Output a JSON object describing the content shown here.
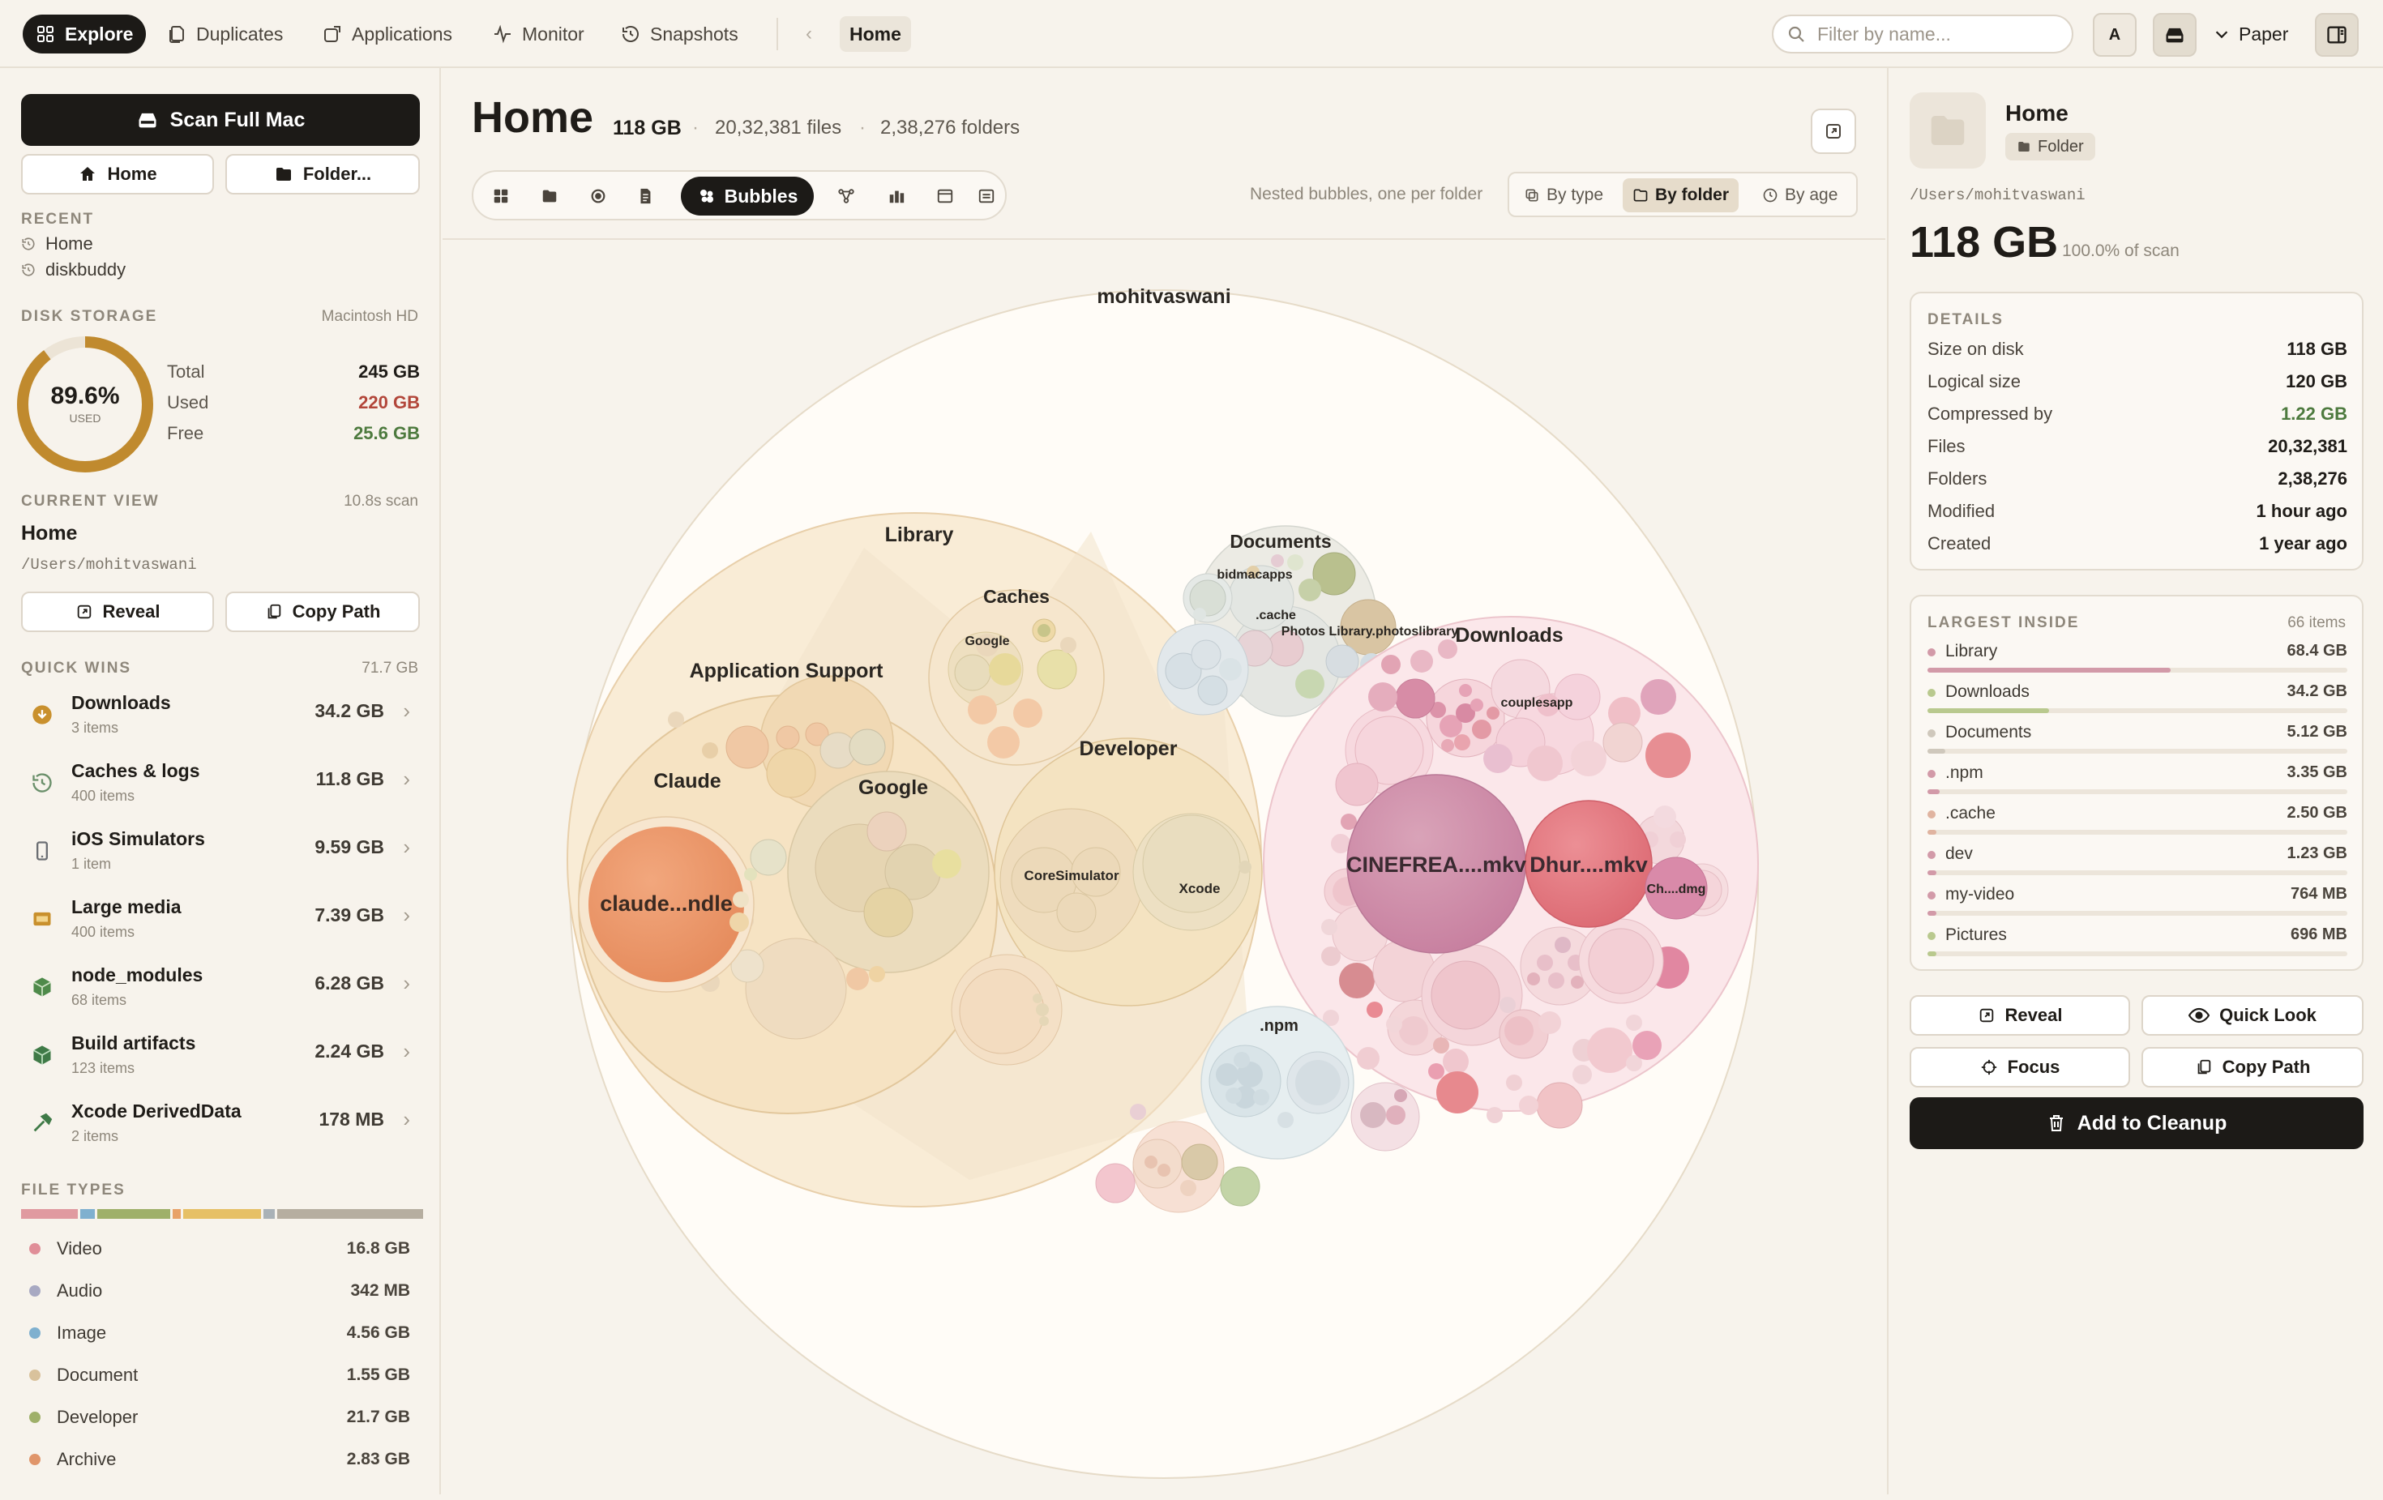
{
  "nav": {
    "tabs": [
      {
        "label": "Explore",
        "icon": "grid-icon"
      },
      {
        "label": "Duplicates",
        "icon": "copy-icon"
      },
      {
        "label": "Applications",
        "icon": "app-icon"
      },
      {
        "label": "Monitor",
        "icon": "pulse-icon"
      },
      {
        "label": "Snapshots",
        "icon": "history-icon"
      }
    ],
    "breadcrumb": "Home",
    "search_placeholder": "Filter by name...",
    "avatar_letter": "A",
    "theme": "Paper"
  },
  "sidebar": {
    "scan_label": "Scan Full Mac",
    "home_label": "Home",
    "folder_label": "Folder...",
    "recent_title": "RECENT",
    "recent": [
      "Home",
      "diskbuddy"
    ],
    "disk": {
      "title": "DISK STORAGE",
      "volume": "Macintosh HD",
      "percent": "89.6%",
      "used_fraction": 0.896,
      "used_caption": "USED",
      "rows": [
        {
          "label": "Total",
          "value": "245 GB",
          "color": "#1f1c18"
        },
        {
          "label": "Used",
          "value": "220 GB",
          "color": "#b2463a"
        },
        {
          "label": "Free",
          "value": "25.6 GB",
          "color": "#4d7a3e"
        }
      ]
    },
    "current": {
      "title": "CURRENT VIEW",
      "scan_time": "10.8s scan",
      "name": "Home",
      "path": "/Users/mohitvaswani",
      "reveal": "Reveal",
      "copy": "Copy Path"
    },
    "quick_wins": {
      "title": "QUICK WINS",
      "total": "71.7 GB",
      "items": [
        {
          "title": "Downloads",
          "sub": "3 items",
          "value": "34.2 GB",
          "icon": "download-icon"
        },
        {
          "title": "Caches & logs",
          "sub": "400 items",
          "value": "11.8 GB",
          "icon": "history-icon"
        },
        {
          "title": "iOS Simulators",
          "sub": "1 item",
          "value": "9.59 GB",
          "icon": "phone-icon"
        },
        {
          "title": "Large media",
          "sub": "400 items",
          "value": "7.39 GB",
          "icon": "film-icon"
        },
        {
          "title": "node_modules",
          "sub": "68 items",
          "value": "6.28 GB",
          "icon": "package-icon"
        },
        {
          "title": "Build artifacts",
          "sub": "123 items",
          "value": "2.24 GB",
          "icon": "box-icon"
        },
        {
          "title": "Xcode DerivedData",
          "sub": "2 items",
          "value": "178 MB",
          "icon": "hammer-icon"
        }
      ]
    },
    "file_types": {
      "title": "FILE TYPES",
      "bar_colors": [
        "#e09aa0",
        "#7fb0cf",
        "#9fb06a",
        "#e8a268",
        "#e6c066",
        "#aab2b7",
        "#b6aea0"
      ],
      "items": [
        {
          "label": "Video",
          "value": "16.8 GB",
          "color": "#e08e98"
        },
        {
          "label": "Audio",
          "value": "342 MB",
          "color": "#a8a9c2"
        },
        {
          "label": "Image",
          "value": "4.56 GB",
          "color": "#7fb0cf"
        },
        {
          "label": "Document",
          "value": "1.55 GB",
          "color": "#d9c29c"
        },
        {
          "label": "Developer",
          "value": "21.7 GB",
          "color": "#9fb06a"
        },
        {
          "label": "Archive",
          "value": "2.83 GB",
          "color": "#e0956a"
        }
      ]
    }
  },
  "main": {
    "title": "Home",
    "size": "118 GB",
    "files": "20,32,381 files",
    "folders": "2,38,276 folders",
    "active_view": "Bubbles",
    "hint": "Nested bubbles, one per folder",
    "color_modes": [
      "By type",
      "By folder",
      "By age"
    ],
    "active_color_mode": "By folder"
  },
  "bubbles": {
    "labels": {
      "root": "mohitvaswani",
      "library": "Library",
      "app_support": "Application Support",
      "claude": "Claude",
      "google": "Google",
      "caches": "Caches",
      "caches_google": "Google",
      "developer": "Developer",
      "coresim": "CoreSimulator",
      "xcode": "Xcode",
      "documents": "Documents",
      "bidmacapps": "bidmacapps",
      "cache": ".cache",
      "photos": "Photos Library.photoslibrary",
      "downloads": "Downloads",
      "couplesapp": "couplesapp",
      "cinefrea": "CINEFREA....mkv",
      "dhur": "Dhur....mkv",
      "chdmg": "Ch....dmg",
      "npm": ".npm",
      "claude_bundle": "claude...ndle"
    }
  },
  "right": {
    "name": "Home",
    "kind": "Folder",
    "path": "/Users/mohitvaswani",
    "size": "118 GB",
    "percent": "100.0% of scan",
    "details_title": "DETAILS",
    "details": [
      {
        "label": "Size on disk",
        "value": "118 GB",
        "color": "#1f1c18"
      },
      {
        "label": "Logical size",
        "value": "120 GB",
        "color": "#1f1c18"
      },
      {
        "label": "Compressed by",
        "value": "1.22 GB",
        "color": "#4d7a3e"
      },
      {
        "label": "Files",
        "value": "20,32,381",
        "color": "#1f1c18"
      },
      {
        "label": "Folders",
        "value": "2,38,276",
        "color": "#1f1c18"
      },
      {
        "label": "Modified",
        "value": "1 hour ago",
        "color": "#1f1c18"
      },
      {
        "label": "Created",
        "value": "1 year ago",
        "color": "#1f1c18"
      }
    ],
    "largest_title": "LARGEST INSIDE",
    "largest_count": "66 items",
    "largest": [
      {
        "name": "Library",
        "value": "68.4 GB",
        "fraction": 0.58,
        "color": "#d29aa8"
      },
      {
        "name": "Downloads",
        "value": "34.2 GB",
        "fraction": 0.29,
        "color": "#b9c98e"
      },
      {
        "name": "Documents",
        "value": "5.12 GB",
        "fraction": 0.043,
        "color": "#cfc8bc"
      },
      {
        "name": ".npm",
        "value": "3.35 GB",
        "fraction": 0.028,
        "color": "#d29aa8"
      },
      {
        "name": ".cache",
        "value": "2.50 GB",
        "fraction": 0.021,
        "color": "#e0b4a0"
      },
      {
        "name": "dev",
        "value": "1.23 GB",
        "fraction": 0.01,
        "color": "#d29aa8"
      },
      {
        "name": "my-video",
        "value": "764 MB",
        "fraction": 0.006,
        "color": "#d29aa8"
      },
      {
        "name": "Pictures",
        "value": "696 MB",
        "fraction": 0.006,
        "color": "#b9c98e"
      }
    ],
    "actions": {
      "reveal": "Reveal",
      "quick_look": "Quick Look",
      "focus": "Focus",
      "copy": "Copy Path"
    },
    "cleanup": "Add to Cleanup"
  }
}
